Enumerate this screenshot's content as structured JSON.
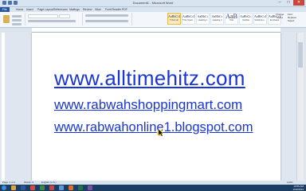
{
  "window": {
    "title": "Document1 - Microsoft Word",
    "controls": {
      "minimize": "–",
      "maximize": "□",
      "close": "✕"
    }
  },
  "ribbon_tabs": [
    "File",
    "Home",
    "Insert",
    "Page Layout",
    "References",
    "Mailings",
    "Review",
    "View",
    "Foxit Reader PDF"
  ],
  "styles": [
    {
      "sample": "AaBbCcDd",
      "name": "¶ Normal"
    },
    {
      "sample": "AaBbCcDd",
      "name": "¶ No Spaci..."
    },
    {
      "sample": "AaBbCc",
      "name": "Heading 1"
    },
    {
      "sample": "AaBbCc",
      "name": "Heading 2"
    },
    {
      "sample": "AaB",
      "name": "Title"
    },
    {
      "sample": "AaBbCc.",
      "name": "Subtitle"
    },
    {
      "sample": "AaBbCcDd",
      "name": "Subtle Em..."
    },
    {
      "sample": "AaBbCcDd",
      "name": "Emphasis"
    }
  ],
  "change_styles_label": "Change Styles",
  "editing": {
    "find": "Find",
    "replace": "Replace",
    "select": "Select"
  },
  "document": {
    "lines": [
      "www.alltimehitz.com",
      "www.rabwahshoppingmart.com",
      "www.rabwahonline1.blogspot.com"
    ]
  },
  "status": {
    "page": "Page: 1 of 1",
    "words": "Words: 3",
    "language": "English (U.S.)",
    "zoom": "110%"
  },
  "taskbar": {
    "time": "10:55 AM",
    "date": "1/22/2014",
    "app_colors": [
      "#e8a13a",
      "#2b579a",
      "#d94a38",
      "#3c8b3c",
      "#c9463d",
      "#5b9bd5",
      "#e06c2b",
      "#217346",
      "#7a4fa0"
    ]
  },
  "colors": {
    "link": "#1a36d6",
    "accent": "#2b579a"
  }
}
